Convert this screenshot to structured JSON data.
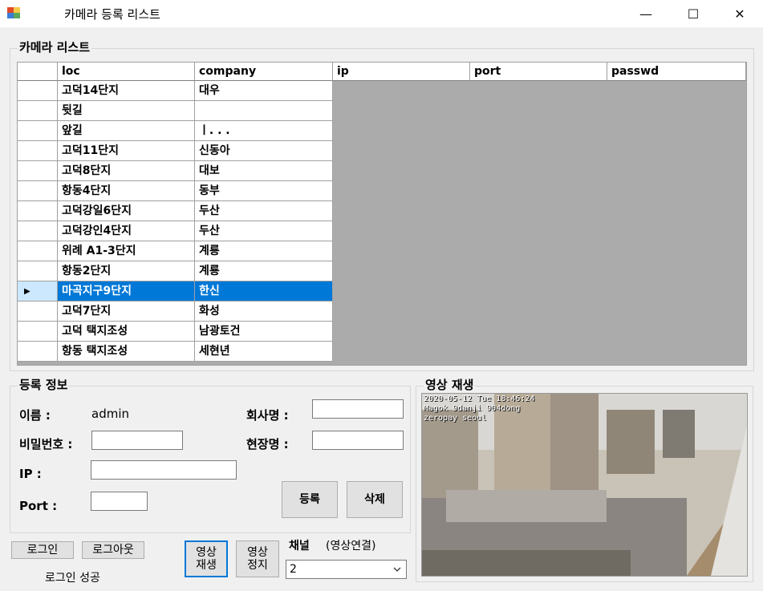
{
  "window": {
    "title": "카메라 등록 리스트",
    "minimize": "—",
    "maximize": "☐",
    "close": "✕"
  },
  "camera_list": {
    "group_label": "카메라 리스트",
    "columns": [
      "loc",
      "company",
      "ip",
      "port",
      "passwd"
    ],
    "rows": [
      {
        "loc": "고덕14단지",
        "company": "대우"
      },
      {
        "loc": "뒷길",
        "company": ""
      },
      {
        "loc": "앞길",
        "company": "ㅣ. . ."
      },
      {
        "loc": "고덕11단지",
        "company": "신동아"
      },
      {
        "loc": "고덕8단지",
        "company": "대보"
      },
      {
        "loc": "항동4단지",
        "company": "동부"
      },
      {
        "loc": "고덕강일6단지",
        "company": "두산"
      },
      {
        "loc": "고덕강인4단지",
        "company": "두산"
      },
      {
        "loc": "위례 A1-3단지",
        "company": "계룡"
      },
      {
        "loc": "항동2단지",
        "company": "계룡"
      },
      {
        "loc": "마곡지구9단지",
        "company": "한신"
      },
      {
        "loc": "고덕7단지",
        "company": "화성"
      },
      {
        "loc": "고덕 택지조성",
        "company": "남광토건"
      },
      {
        "loc": "항동 택지조성",
        "company": "세현년"
      }
    ],
    "selected_index": 10,
    "selected_marker": "▶"
  },
  "registration": {
    "group_label": "등록 정보",
    "name_label": "이름 :",
    "name_value": "admin",
    "password_label": "비밀번호 :",
    "ip_label": "IP :",
    "port_label": "Port :",
    "company_label": "회사명 :",
    "site_label": "현장명 :",
    "register_button": "등록",
    "delete_button": "삭제"
  },
  "bottom": {
    "login_button": "로그인",
    "logout_button": "로그아웃",
    "login_status": "로그인 성공",
    "play_button": "영상\n재생",
    "stop_button": "영상\n정지",
    "channel_label": "채널",
    "channel_hint": "(영상연결)",
    "channel_value": "2"
  },
  "video": {
    "group_label": "영상 재생",
    "overlay_line1": "2020-05-12 Tue 18:46:24",
    "overlay_line2": "Magok 9danji 904dong",
    "overlay_line3": "zeropay seoul"
  },
  "colors": {
    "selection": "#0078d7",
    "row_header_selected": "#cce8ff"
  }
}
